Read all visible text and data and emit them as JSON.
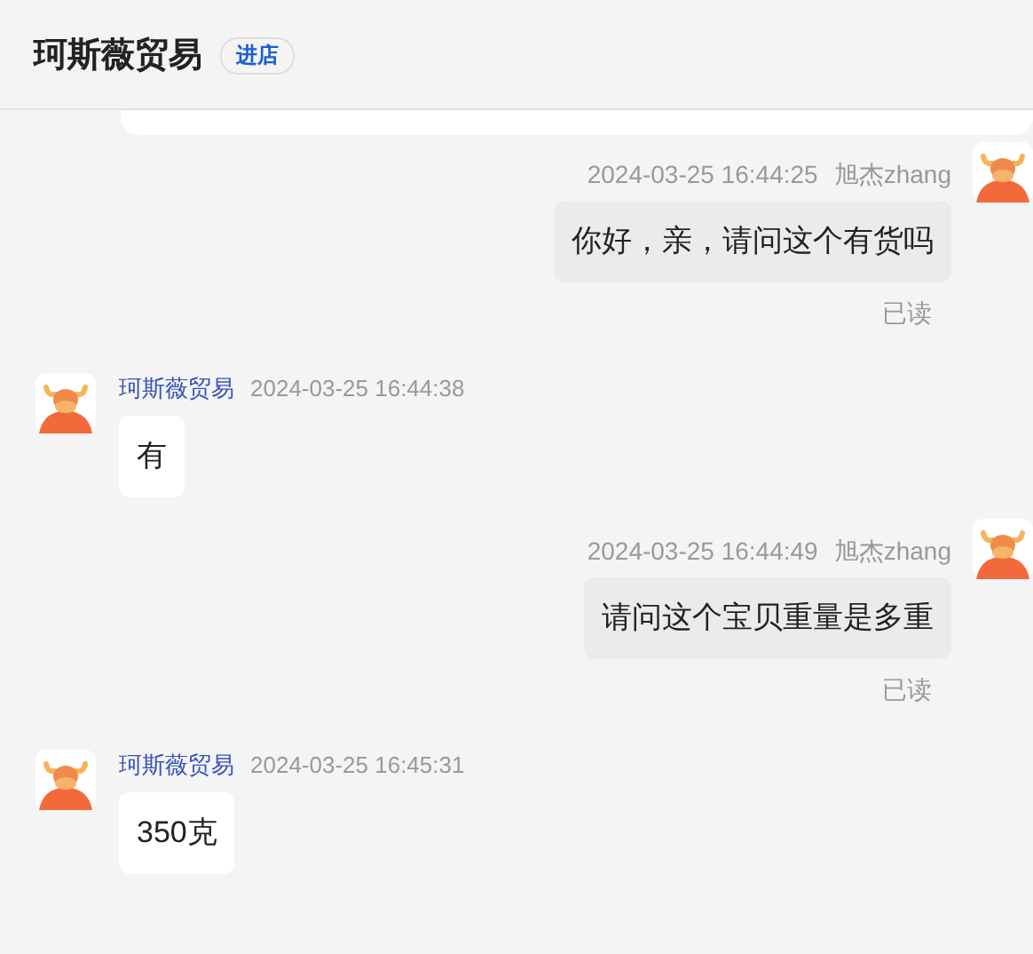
{
  "header": {
    "shop_name": "珂斯薇贸易",
    "enter_button": "进店"
  },
  "messages": [
    {
      "kind": "outgoing",
      "time": "2024-03-25 16:44:25",
      "sender": "旭杰zhang",
      "text": "你好，亲，请问这个有货吗",
      "status": "已读"
    },
    {
      "kind": "incoming",
      "sender": "珂斯薇贸易",
      "time": "2024-03-25 16:44:38",
      "text": "有"
    },
    {
      "kind": "outgoing",
      "time": "2024-03-25 16:44:49",
      "sender": "旭杰zhang",
      "text": "请问这个宝贝重量是多重",
      "status": "已读"
    },
    {
      "kind": "incoming",
      "sender": "珂斯薇贸易",
      "time": "2024-03-25 16:45:31",
      "text": "350克"
    }
  ]
}
